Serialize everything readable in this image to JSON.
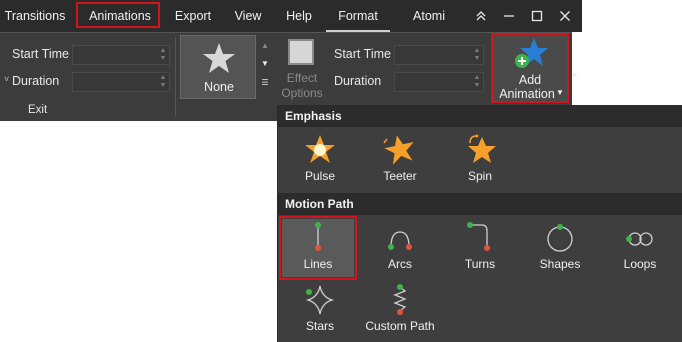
{
  "tabs": {
    "transitions": "Transitions",
    "animations": "Animations",
    "export": "Export",
    "view": "View",
    "help": "Help",
    "format": "Format",
    "atomi": "Atomi"
  },
  "window": {
    "collapse": "≈",
    "minimize": "—",
    "maximize": "☐",
    "close": "✕"
  },
  "ribbon": {
    "start_time_label": "Start Time",
    "duration_label": "Duration",
    "exit_label": "Exit",
    "start_time_value": "",
    "duration_value": "",
    "animation_selected": "None",
    "effect_options_line1": "Effect",
    "effect_options_line2": "Options",
    "start_time2_label": "Start Time",
    "duration2_label": "Duration",
    "add_animation_line1": "Add",
    "add_animation_line2": "Animation"
  },
  "emphasis": {
    "header": "Emphasis",
    "items": [
      "Pulse",
      "Teeter",
      "Spin"
    ]
  },
  "motion_path": {
    "header": "Motion Path",
    "items": [
      "Lines",
      "Arcs",
      "Turns",
      "Shapes",
      "Loops",
      "Stars",
      "Custom Path"
    ]
  },
  "colors": {
    "accent_red": "#d0161c",
    "star_orange": "#f5a02a",
    "path_green": "#3cb44b",
    "path_red": "#e5533c",
    "add_star_blue": "#2a7fd4"
  }
}
